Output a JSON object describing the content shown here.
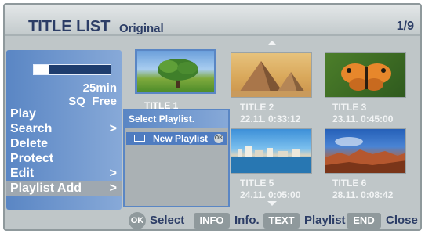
{
  "header": {
    "title": "TITLE LIST",
    "subtitle": "Original",
    "page": "1/9"
  },
  "disc": {
    "progress": 0.2,
    "time": "25min",
    "mode": "SQ  Free"
  },
  "menu": [
    {
      "label": "Play",
      "arrow": ""
    },
    {
      "label": "Search",
      "arrow": ">"
    },
    {
      "label": "Delete",
      "arrow": ""
    },
    {
      "label": "Protect",
      "arrow": ""
    },
    {
      "label": "Edit",
      "arrow": ">"
    },
    {
      "label": "Playlist Add",
      "arrow": ">"
    }
  ],
  "titles": [
    {
      "name": "TITLE 1",
      "date": ""
    },
    {
      "name": "TITLE 2",
      "date": "22.11.  0:33:12"
    },
    {
      "name": "TITLE 3",
      "date": "23.11.  0:45:00"
    },
    {
      "name": "TITLE 5",
      "date": "24.11.  0:05:00"
    },
    {
      "name": "TITLE 6",
      "date": "28.11.  0:08:42"
    }
  ],
  "popup": {
    "title": "Select Playlist.",
    "item": "New Playlist",
    "item_badge": "OK"
  },
  "footer": {
    "ok_key": "OK",
    "select": "Select",
    "info_key": "INFO",
    "info": "Info.",
    "text_key": "TEXT",
    "playlist": "Playlist",
    "end_key": "END",
    "close": "Close"
  }
}
